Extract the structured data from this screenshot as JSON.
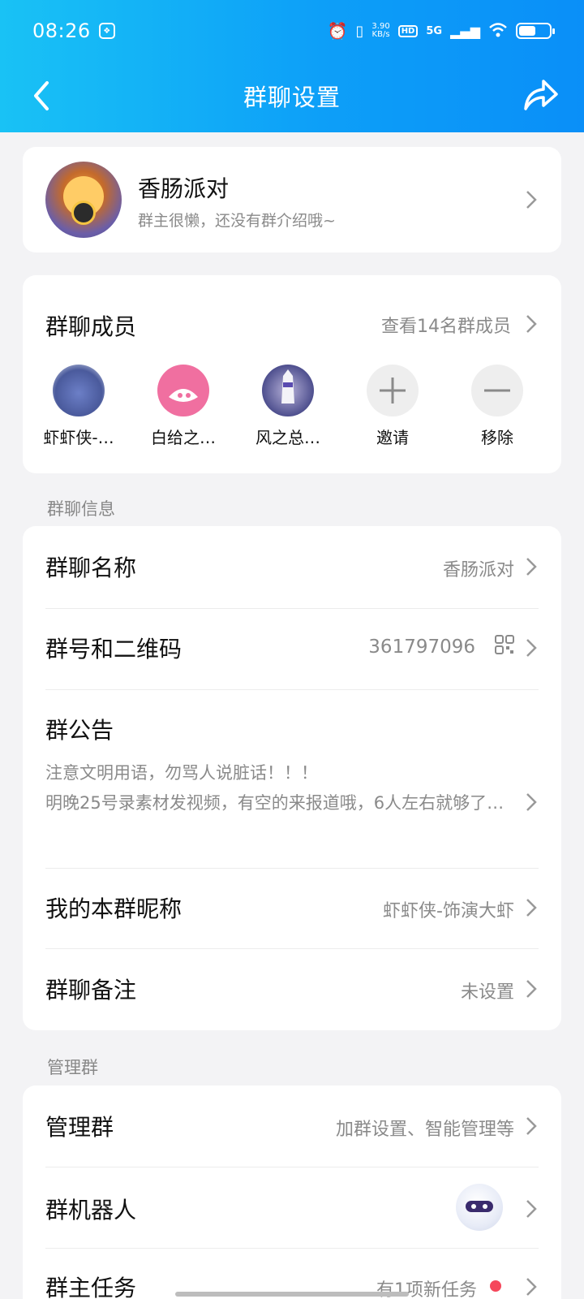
{
  "status_bar": {
    "time": "08:26",
    "net_speed_value": "3.90",
    "net_speed_unit": "KB/s",
    "hd": "HD",
    "network": "5G",
    "battery_level": 0.55
  },
  "header": {
    "title": "群聊设置"
  },
  "group": {
    "name": "香肠派对",
    "desc": "群主很懒，还没有群介绍哦~"
  },
  "members": {
    "title": "群聊成员",
    "view_all": "查看14名群成员",
    "list": [
      {
        "name": "虾虾侠-…"
      },
      {
        "name": "白给之…"
      },
      {
        "name": "风之总…"
      }
    ],
    "invite": "邀请",
    "remove": "移除"
  },
  "info_section": {
    "label": "群聊信息",
    "group_name_label": "群聊名称",
    "group_name_value": "香肠派对",
    "group_id_label": "群号和二维码",
    "group_id_value": "361797096",
    "notice_label": "群公告",
    "notice_text": "注意文明用语，勿骂人说脏话！！！\n明晚25号录素材发视频，有空的来报道哦，6人左右就够了…",
    "nickname_label": "我的本群昵称",
    "nickname_value": "虾虾侠-饰演大虾",
    "remark_label": "群聊备注",
    "remark_value": "未设置"
  },
  "manage_section": {
    "label": "管理群",
    "manage_label": "管理群",
    "manage_value": "加群设置、智能管理等",
    "robot_label": "群机器人",
    "task_label": "群主任务",
    "task_value": "有1项新任务"
  },
  "colors": {
    "header_start": "#19c2f5",
    "header_end": "#0a8ff8",
    "badge_red": "#f5475b"
  }
}
